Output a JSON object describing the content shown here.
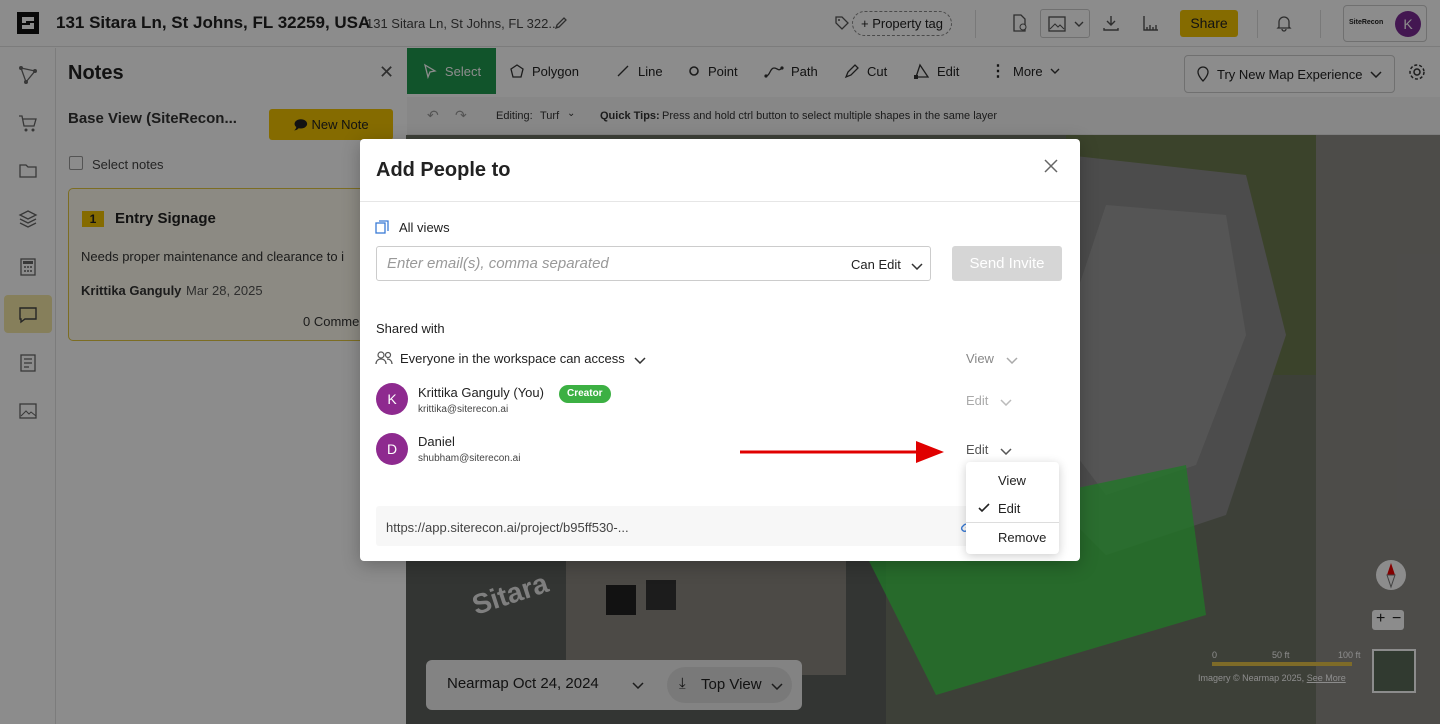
{
  "header": {
    "address_title": "131 Sitara Ln, St Johns, FL 32259, USA",
    "address_sub": "131 Sitara Ln, St Johns, FL 322...",
    "property_tag": "+ Property tag",
    "share_label": "Share",
    "sr_logo_text": "SiteRecon",
    "avatar_initial": "K"
  },
  "notes": {
    "title": "Notes",
    "base_view": "Base View (SiteRecon...",
    "new_note_label": "New Note",
    "select_notes": "Select notes",
    "card": {
      "number": "1",
      "title": "Entry Signage",
      "body": "Needs proper maintenance and clearance to i",
      "author": "Krittika Ganguly",
      "date": "Mar 28, 2025",
      "comments": "0 Comme"
    }
  },
  "toolbar": {
    "tools": [
      "Select",
      "Polygon",
      "Line",
      "Point",
      "Path",
      "Cut",
      "Edit",
      "More"
    ],
    "new_map": "Try New Map Experience",
    "editing_label": "Editing:",
    "editing_value": "Turf",
    "quick_tips_label": "Quick Tips:",
    "quick_tips_text": "Press and hold ctrl button to select multiple shapes in the same layer"
  },
  "map": {
    "date": "Nearmap Oct 24, 2024",
    "view": "Top View",
    "street_label": "Sitara",
    "scale": [
      "0",
      "50 ft",
      "100 ft"
    ],
    "attribution": "Imagery © Nearmap 2025,",
    "see_more": "See More",
    "zoom_in": "+",
    "zoom_out": "−"
  },
  "modal": {
    "title": "Add People to",
    "all_views": "All views",
    "email_placeholder": "Enter email(s), comma separated",
    "permission": "Can Edit",
    "send_invite": "Send Invite",
    "shared_with": "Shared with",
    "everyone": "Everyone in the workspace can access",
    "everyone_perm": "View",
    "users": [
      {
        "initial": "K",
        "name": "Krittika Ganguly (You)",
        "email": "krittika@siterecon.ai",
        "perm": "Edit",
        "badge": "Creator"
      },
      {
        "initial": "D",
        "name": "Daniel",
        "email": "shubham@siterecon.ai",
        "perm": "Edit"
      }
    ],
    "link": "https://app.siterecon.ai/project/b95ff530-..."
  },
  "dropdown": {
    "items": [
      "View",
      "Edit",
      "Remove"
    ]
  },
  "colors": {
    "accent": "#f2c400",
    "tool_active": "#1f9a4f",
    "avatar": "#8e2a8f",
    "arrow": "#e00000",
    "creator": "#3cb043"
  }
}
